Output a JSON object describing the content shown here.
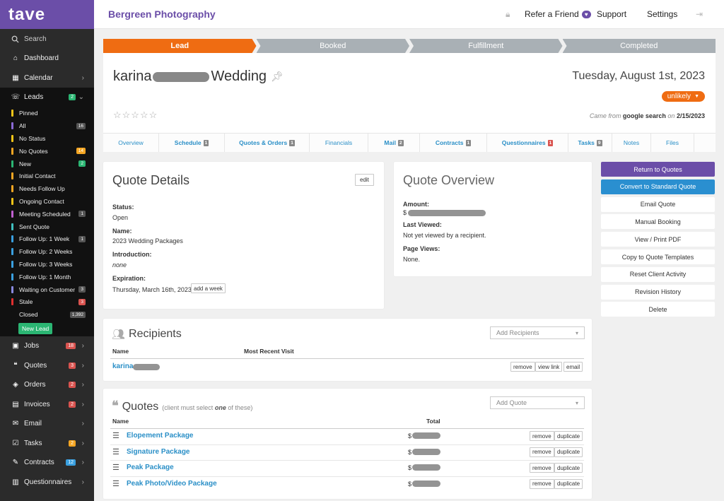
{
  "app": {
    "logo": "tave",
    "studio": "Bergreen Photography"
  },
  "topbar": {
    "refer": "Refer a Friend",
    "support": "Support",
    "settings": "Settings"
  },
  "sidebar": {
    "search": "Search",
    "items": [
      {
        "label": "Dashboard",
        "icon": "home-icon"
      },
      {
        "label": "Calendar",
        "icon": "calendar-icon"
      },
      {
        "label": "Leads",
        "icon": "leads-icon",
        "count": "2"
      }
    ],
    "sub": [
      {
        "label": "Pinned",
        "color": "#f5c518",
        "count": ""
      },
      {
        "label": "All",
        "color": "#8a6ad6",
        "count": "16"
      },
      {
        "label": "No Status",
        "color": "#f5c518",
        "count": ""
      },
      {
        "label": "No Quotes",
        "color": "#f5a623",
        "count": "14"
      },
      {
        "label": "New",
        "color": "#2bb673",
        "count": "2"
      },
      {
        "label": "Initial Contact",
        "color": "#f5a623",
        "count": ""
      },
      {
        "label": "Needs Follow Up",
        "color": "#f5a623",
        "count": ""
      },
      {
        "label": "Ongoing Contact",
        "color": "#f5c518",
        "count": ""
      },
      {
        "label": "Meeting Scheduled",
        "color": "#c060d0",
        "count": "1"
      },
      {
        "label": "Sent Quote",
        "color": "#40c0c0",
        "count": ""
      },
      {
        "label": "Follow Up: 1 Week",
        "color": "#3aa0e0",
        "count": "1"
      },
      {
        "label": "Follow Up: 2 Weeks",
        "color": "#3aa0e0",
        "count": ""
      },
      {
        "label": "Follow Up: 3 Weeks",
        "color": "#3aa0e0",
        "count": ""
      },
      {
        "label": "Follow Up: 1 Month",
        "color": "#3aa0e0",
        "count": ""
      },
      {
        "label": "Waiting on Customer",
        "color": "#8a8ae0",
        "count": "3"
      },
      {
        "label": "Stale",
        "color": "#e03030",
        "count": "3"
      },
      {
        "label": "Closed",
        "color": "#111111",
        "count": "1,392"
      }
    ],
    "new_lead": "New Lead",
    "bottom": [
      {
        "label": "Jobs",
        "icon": "jobs-icon",
        "count": "18",
        "color": "#d9534f"
      },
      {
        "label": "Quotes",
        "icon": "quotes-icon",
        "count": "3",
        "color": "#d9534f"
      },
      {
        "label": "Orders",
        "icon": "orders-icon",
        "count": "2",
        "color": "#d9534f"
      },
      {
        "label": "Invoices",
        "icon": "invoices-icon",
        "count": "2",
        "color": "#d9534f"
      },
      {
        "label": "Email",
        "icon": "email-icon",
        "count": "",
        "color": ""
      },
      {
        "label": "Tasks",
        "icon": "tasks-icon",
        "count": "2",
        "color": "#f5a623"
      },
      {
        "label": "Contracts",
        "icon": "contracts-icon",
        "count": "12",
        "color": "#3aa0e0"
      },
      {
        "label": "Questionnaires",
        "icon": "questionnaires-icon",
        "count": "",
        "color": ""
      }
    ]
  },
  "stages": [
    "Lead",
    "Booked",
    "Fulfillment",
    "Completed"
  ],
  "lead": {
    "first": "karina",
    "second": "Wedding",
    "date": "Tuesday, August 1st, 2023",
    "status": "unlikely",
    "came_from_pre": "Came from",
    "source": "google search",
    "on": "on",
    "source_date": "2/15/2023"
  },
  "tabs": [
    {
      "label": "Overview",
      "n": ""
    },
    {
      "label": "Schedule",
      "n": "1"
    },
    {
      "label": "Quotes & Orders",
      "n": "1"
    },
    {
      "label": "Financials",
      "n": ""
    },
    {
      "label": "Mail",
      "n": "2"
    },
    {
      "label": "Contracts",
      "n": "1"
    },
    {
      "label": "Questionnaires",
      "n": "1"
    },
    {
      "label": "Tasks",
      "n": "9"
    },
    {
      "label": "Notes",
      "n": ""
    },
    {
      "label": "Files",
      "n": ""
    }
  ],
  "quote_details": {
    "title": "Quote Details",
    "edit": "edit",
    "status_label": "Status:",
    "status": "Open",
    "name_label": "Name:",
    "name": "2023 Wedding Packages",
    "intro_label": "Introduction:",
    "intro": "none",
    "exp_label": "Expiration:",
    "exp": "Thursday, March 16th, 2023",
    "add_week": "add a week"
  },
  "quote_overview": {
    "title": "Quote Overview",
    "amount_label": "Amount:",
    "amount_prefix": "$",
    "viewed_label": "Last Viewed:",
    "viewed": "Not yet viewed by a recipient.",
    "views_label": "Page Views:",
    "views": "None."
  },
  "actions": [
    "Return to Quotes",
    "Convert to Standard Quote",
    "Email Quote",
    "Manual Booking",
    "View / Print PDF",
    "Copy to Quote Templates",
    "Reset Client Activity",
    "Revision History",
    "Delete"
  ],
  "recipients": {
    "title": "Recipients",
    "add": "Add Recipients",
    "col_name": "Name",
    "col_visit": "Most Recent Visit",
    "name": "karina",
    "remove": "remove",
    "view_link": "view link",
    "email": "email"
  },
  "quotes": {
    "title": "Quotes",
    "note_pre": "(client must select",
    "note_em": "one",
    "note_post": "of these)",
    "add": "Add Quote",
    "col_name": "Name",
    "col_total": "Total",
    "remove": "remove",
    "duplicate": "duplicate",
    "rows": [
      {
        "name": "Elopement Package",
        "cur": "$"
      },
      {
        "name": "Signature Package",
        "cur": "$"
      },
      {
        "name": "Peak Package",
        "cur": "$"
      },
      {
        "name": "Peak Photo/Video Package",
        "cur": "$"
      }
    ]
  }
}
